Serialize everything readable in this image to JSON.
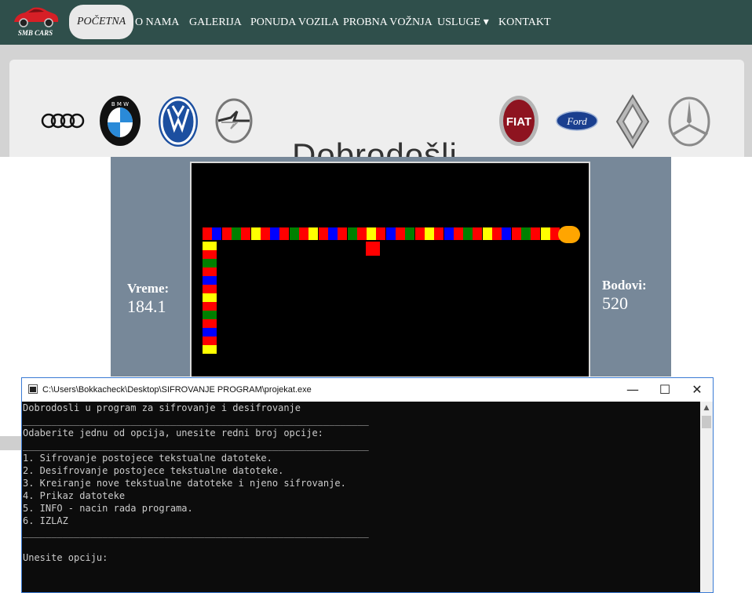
{
  "navbar": {
    "logo_text": "SMB CARS",
    "items": [
      {
        "label": "POČETNA",
        "active": true
      },
      {
        "label": "O NAMA"
      },
      {
        "label": "GALERIJA"
      },
      {
        "label": "PONUDA VOZILA"
      },
      {
        "label": "PROBNA VOŽNJA"
      },
      {
        "label": "USLUGE ▾"
      },
      {
        "label": "KONTAKT"
      }
    ]
  },
  "brands": {
    "welcome_text": "Dobrodošli",
    "logos": [
      "audi-logo",
      "bmw-logo",
      "volkswagen-logo",
      "opel-logo",
      "fiat-logo",
      "ford-logo",
      "renault-logo",
      "mercedes-logo"
    ],
    "fiat_text": "FIAT",
    "ford_text": "Ford"
  },
  "game": {
    "time_label": "Vreme:",
    "time_value": "184.1",
    "score_label": "Bodovi:",
    "score_value": "520",
    "colors": {
      "red": "#ff0000",
      "blue": "#0000ff",
      "green": "#008000",
      "yellow": "#ffff00",
      "head": "#ffa500"
    }
  },
  "console": {
    "title": "C:\\Users\\Bokkacheck\\Desktop\\SIFROVANJE PROGRAM\\projekat.exe",
    "lines": [
      "Dobrodosli u program za sifrovanje i desifrovanje",
      "_____________________________________________________________",
      "Odaberite jednu od opcija, unesite redni broj opcije:",
      "_____________________________________________________________",
      "1. Sifrovanje postojece tekstualne datoteke.",
      "2. Desifrovanje postojece tekstualne datoteke.",
      "3. Kreiranje nove tekstualne datoteke i njeno sifrovanje.",
      "4. Prikaz datoteke",
      "5. INFO - nacin rada programa.",
      "6. IZLAZ",
      "_____________________________________________________________",
      "",
      "Unesite opciju:"
    ],
    "minimize": "—",
    "maximize": "☐",
    "close": "✕",
    "scroll_up": "▲"
  }
}
